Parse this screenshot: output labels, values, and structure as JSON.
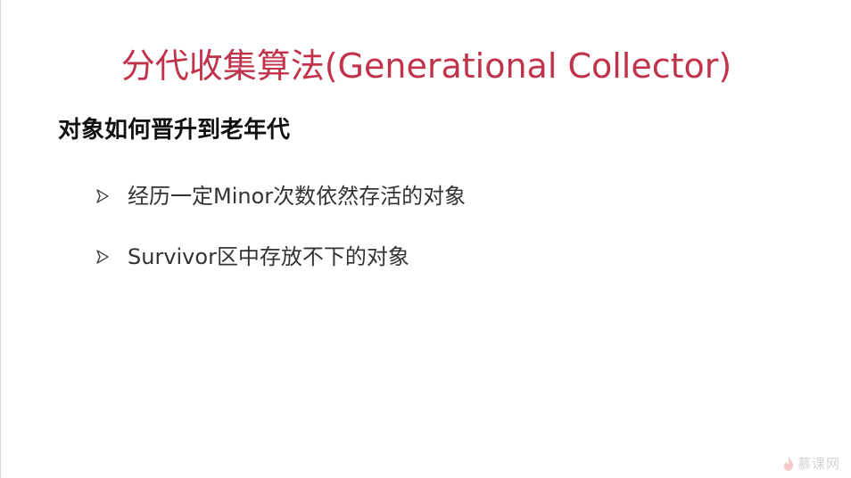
{
  "slide": {
    "title": "分代收集算法(Generational Collector)",
    "subtitle": "对象如何晋升到老年代",
    "bullets": [
      {
        "icon": "arrow-bullet-icon",
        "text": "经历一定Minor次数依然存活的对象"
      },
      {
        "icon": "arrow-bullet-icon",
        "text": "Survivor区中存放不下的对象"
      }
    ]
  },
  "watermark": {
    "icon": "flame-icon",
    "text": "慕课网"
  },
  "colors": {
    "title": "#c0334a",
    "subtitle": "#111111",
    "body": "#333333"
  }
}
